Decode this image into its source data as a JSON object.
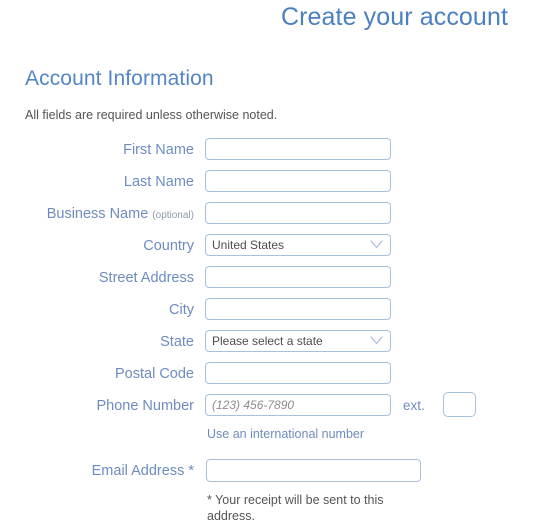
{
  "page": {
    "title": "Create your account",
    "section_heading": "Account Information",
    "section_note": "All fields are required unless otherwise noted.",
    "title_color": "#4a7fc1",
    "heading_color": "#5585c7",
    "label_color": "#6d8cc0",
    "border_color": "#a9c0dc",
    "note_color": "#555555"
  },
  "fields": {
    "first_name": {
      "label": "First Name",
      "value": "",
      "placeholder": ""
    },
    "last_name": {
      "label": "Last Name",
      "value": "",
      "placeholder": ""
    },
    "business_name": {
      "label": "Business Name",
      "optional_tag": "(optional)",
      "value": "",
      "placeholder": ""
    },
    "country": {
      "label": "Country",
      "selected": "United States",
      "icon": "chevron-down-icon"
    },
    "street_address": {
      "label": "Street Address",
      "value": "",
      "placeholder": ""
    },
    "city": {
      "label": "City",
      "value": "",
      "placeholder": ""
    },
    "state": {
      "label": "State",
      "selected": "Please select a state",
      "icon": "chevron-down-icon"
    },
    "postal_code": {
      "label": "Postal Code",
      "value": "",
      "placeholder": ""
    },
    "phone_number": {
      "label": "Phone Number",
      "value": "",
      "placeholder": "(123) 456-7890",
      "ext_label": "ext.",
      "ext_value": "",
      "helper_link": "Use an international number"
    },
    "email_address": {
      "label": "Email Address *",
      "value": "",
      "placeholder": "",
      "helper_note": "* Your receipt will be sent to this address."
    }
  }
}
